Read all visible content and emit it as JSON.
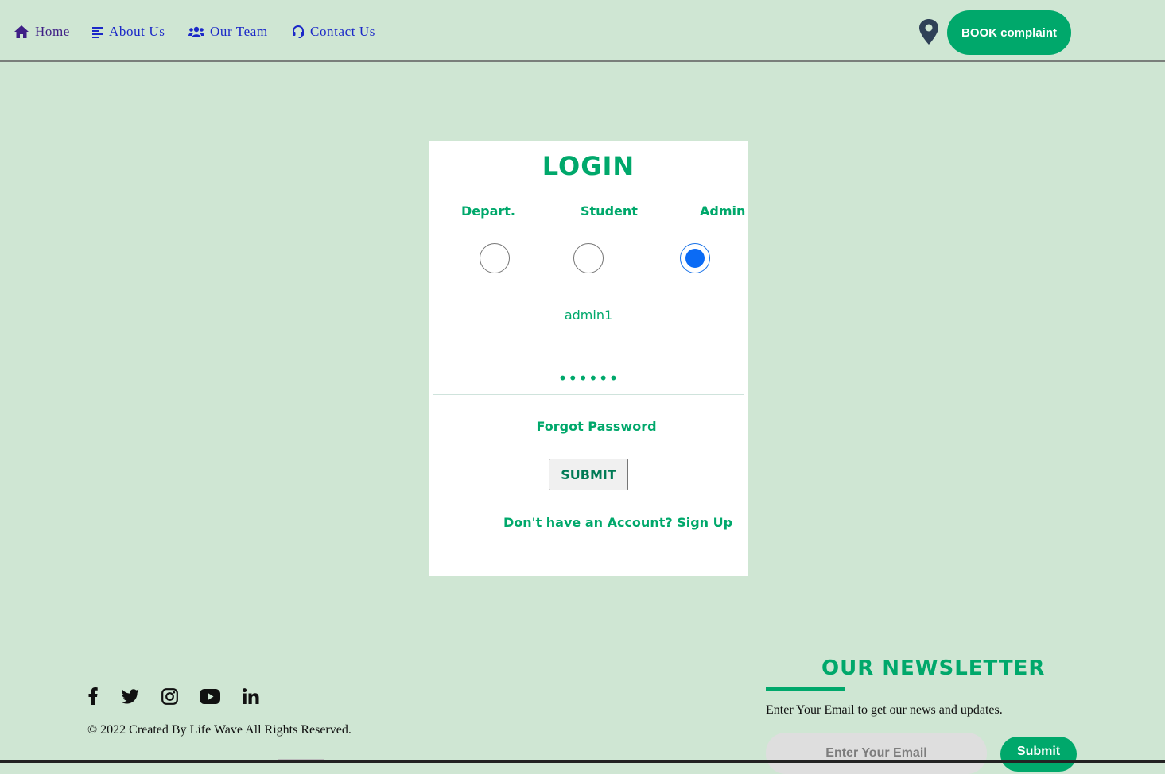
{
  "nav": {
    "items": [
      {
        "label": "Home",
        "icon": "home-icon"
      },
      {
        "label": "About Us",
        "icon": "align-left-icon"
      },
      {
        "label": "Our Team",
        "icon": "users-icon"
      },
      {
        "label": "Contact Us",
        "icon": "headset-icon"
      }
    ],
    "location_icon": "map-marker-icon",
    "book_button": "BOOK complaint"
  },
  "login": {
    "title": "LOGIN",
    "roles": [
      "Depart.",
      "Student",
      "Admin"
    ],
    "selected_role": "Admin",
    "username": "admin1",
    "password": "••••••",
    "forgot": "Forgot Password",
    "submit": "SUBMIT",
    "signup": "Don't have an Account? Sign Up"
  },
  "footer": {
    "social": [
      "facebook-icon",
      "twitter-icon",
      "instagram-icon",
      "youtube-icon",
      "linkedin-icon"
    ],
    "copyright": "© 2022 Created By Life Wave All Rights Reserved."
  },
  "newsletter": {
    "title": "OUR NEWSLETTER",
    "description": "Enter Your Email to get our news and updates.",
    "placeholder": "Enter Your Email",
    "button": "Submit"
  },
  "colors": {
    "background": "#cfe6d3",
    "accent": "#00a86b",
    "nav_link": "#1b28c8",
    "radio_selected": "#0b6bf5"
  }
}
